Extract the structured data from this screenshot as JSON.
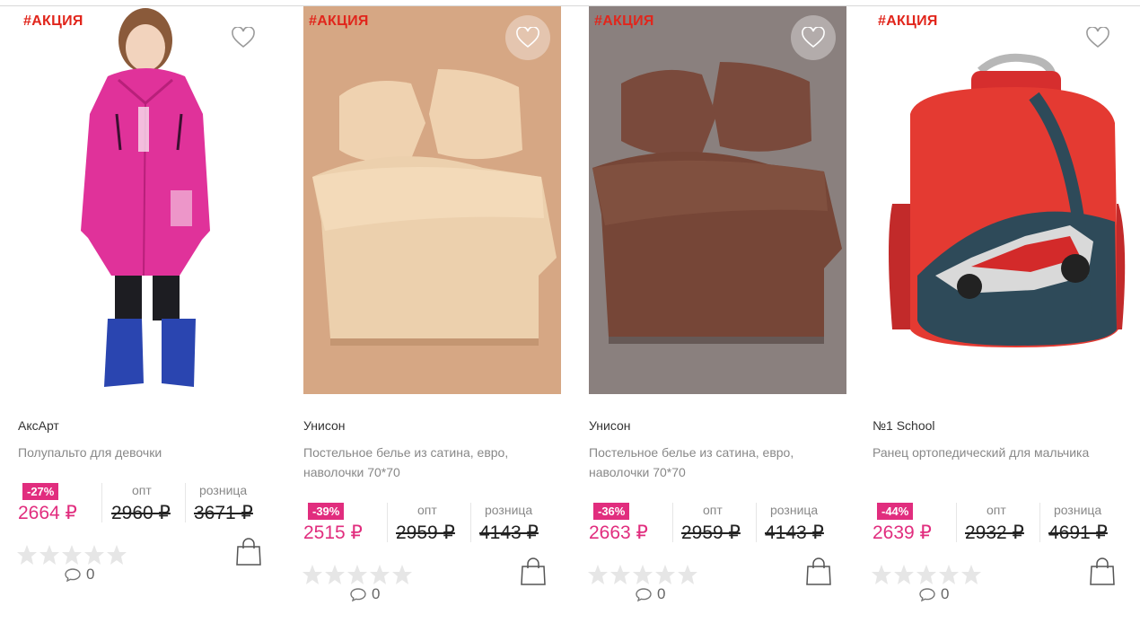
{
  "products": [
    {
      "tag": "#АКЦИЯ",
      "brand": "АксАрт",
      "title": "Полупальто для девочки",
      "discount": "-27%",
      "price": "2664 ₽",
      "opt_label": "опт",
      "opt_price": "2960 ₽",
      "retail_label": "розница",
      "retail_price": "3671 ₽",
      "rating": 0,
      "comments": "0",
      "image": "pink-coat-photo"
    },
    {
      "tag": "#АКЦИЯ",
      "brand": "Унисон",
      "title": "Постельное белье из сатина, евро, наволочки 70*70",
      "discount": "-39%",
      "price": "2515 ₽",
      "opt_label": "опт",
      "opt_price": "2959 ₽",
      "retail_label": "розница",
      "retail_price": "4143 ₽",
      "rating": 0,
      "comments": "0",
      "image": "beige-bedding-photo"
    },
    {
      "tag": "#АКЦИЯ",
      "brand": "Унисон",
      "title": "Постельное белье из сатина, евро, наволочки 70*70",
      "discount": "-36%",
      "price": "2663 ₽",
      "opt_label": "опт",
      "opt_price": "2959 ₽",
      "retail_label": "розница",
      "retail_price": "4143 ₽",
      "rating": 0,
      "comments": "0",
      "image": "brown-bedding-photo"
    },
    {
      "tag": "#АКЦИЯ",
      "brand": "№1 School",
      "title": "Ранец ортопедический для мальчика",
      "discount": "-44%",
      "price": "2639 ₽",
      "opt_label": "опт",
      "opt_price": "2932 ₽",
      "retail_label": "розница",
      "retail_price": "4691 ₽",
      "rating": 0,
      "comments": "0",
      "image": "red-backpack-photo"
    }
  ],
  "colors": {
    "tag": "#e1261c",
    "accent": "#e12d7e",
    "star_empty": "#e6e6e6"
  }
}
